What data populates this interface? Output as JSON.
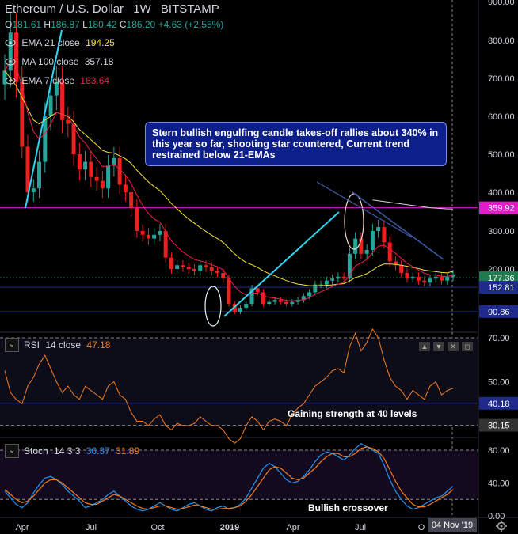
{
  "header": {
    "symbol": "Ethereum / U.S. Dollar",
    "interval": "1W",
    "exchange": "BITSTAMP",
    "ohlc": {
      "o_label": "O",
      "o": "181.61",
      "h_label": "H",
      "h": "186.87",
      "l_label": "L",
      "l": "180.42",
      "c_label": "C",
      "c": "186.20",
      "chg": "+4.63 (+2.55%)"
    }
  },
  "indicators": [
    {
      "label": "EMA 21 close",
      "value": "194.25",
      "color": "#f5e33b"
    },
    {
      "label": "MA 100 close",
      "value": "357.18",
      "color": "#d1d4dc"
    },
    {
      "label": "EMA 7 close",
      "value": "183.64",
      "color": "#ef1f4b"
    }
  ],
  "annotation_box": {
    "text": "Stern bullish engulfing candle takes-off rallies about 340% in this year so far, shooting star countered, Current trend restrained below 21-EMAs"
  },
  "price_badges": [
    {
      "text": "359.92",
      "color": "#e31ec8"
    },
    {
      "text": "177.36",
      "color": "#1f7a4d"
    },
    {
      "text": "152.81",
      "color": "#1e2a8c"
    },
    {
      "text": "90.86",
      "color": "#1e2a8c"
    }
  ],
  "rsi": {
    "label": "RSI",
    "params": "14 close",
    "value": "47.18",
    "value_color": "#f57c1f",
    "badges": [
      {
        "text": "40.18",
        "color": "#1e2a8c"
      },
      {
        "text": "30.15",
        "color": "#333"
      }
    ],
    "annotation": "Gaining strength at 40 levels"
  },
  "stoch": {
    "label": "Stoch",
    "params": "14 3 3",
    "k": "36.37",
    "k_color": "#2196f3",
    "d": "31.89",
    "d_color": "#f57c1f",
    "annotation": "Bullish crossover"
  },
  "x_axis": {
    "labels": [
      "Apr",
      "Jul",
      "Oct",
      "2019",
      "Apr",
      "Jul",
      "O"
    ],
    "crosshair_date": "04 Nov '19"
  },
  "colors": {
    "up": "#26a69a",
    "down": "#ef1f1f",
    "bg": "#000000",
    "hline": "#1e2a8c",
    "magenta": "#e31ec8",
    "cyan": "#2fd4f0"
  },
  "chart_data": [
    {
      "type": "line",
      "title": "Ethereum / U.S. Dollar 1W BITSTAMP",
      "y_ticks": [
        900,
        800,
        700,
        600,
        500,
        400,
        300,
        200
      ],
      "ylim": [
        45,
        900
      ],
      "x_ticks": [
        "Apr",
        "Jul",
        "Oct",
        "2019",
        "Apr",
        "Jul",
        "O"
      ],
      "series": [
        {
          "name": "Close",
          "kind": "candles",
          "values": [
            720,
            820,
            690,
            520,
            400,
            410,
            480,
            600,
            655,
            690,
            590,
            580,
            500,
            460,
            480,
            440,
            430,
            410,
            470,
            490,
            420,
            400,
            360,
            300,
            290,
            280,
            290,
            300,
            230,
            200,
            210,
            205,
            200,
            195,
            210,
            205,
            195,
            190,
            175,
            110,
            90,
            100,
            110,
            150,
            140,
            110,
            115,
            120,
            115,
            110,
            115,
            120,
            130,
            140,
            160,
            160,
            170,
            175,
            180,
            175,
            240,
            280,
            240,
            250,
            300,
            310,
            270,
            220,
            210,
            190,
            175,
            180,
            170,
            165,
            175,
            180,
            170,
            180,
            186
          ]
        },
        {
          "name": "EMA 21 close",
          "values": [
            720,
            700,
            680,
            650,
            620,
            590,
            580,
            590,
            600,
            610,
            605,
            600,
            585,
            565,
            552,
            538,
            525,
            510,
            505,
            503,
            496,
            488,
            476,
            458,
            442,
            427,
            415,
            404,
            388,
            371,
            357,
            343,
            331,
            320,
            309,
            299,
            289,
            280,
            270,
            255,
            240,
            227,
            217,
            211,
            204,
            195,
            188,
            182,
            176,
            170,
            165,
            161,
            159,
            157,
            157,
            157,
            158,
            159,
            161,
            162,
            169,
            178,
            182,
            188,
            197,
            207,
            213,
            213,
            212,
            210,
            207,
            204,
            201,
            197,
            195,
            193,
            191,
            190,
            194
          ]
        },
        {
          "name": "EMA 7 close",
          "values": [
            720,
            745,
            731,
            678,
            609,
            560,
            540,
            555,
            580,
            610,
            605,
            599,
            574,
            545,
            530,
            507,
            488,
            468,
            469,
            474,
            460,
            445,
            423,
            392,
            366,
            345,
            331,
            323,
            299,
            274,
            258,
            245,
            234,
            225,
            221,
            217,
            211,
            206,
            198,
            176,
            155,
            141,
            133,
            137,
            138,
            131,
            127,
            125,
            122,
            119,
            118,
            119,
            121,
            126,
            135,
            141,
            148,
            155,
            161,
            165,
            184,
            208,
            216,
            225,
            243,
            260,
            263,
            252,
            241,
            228,
            215,
            206,
            197,
            189,
            185,
            184,
            181,
            181,
            183
          ]
        },
        {
          "name": "MA 100 close",
          "values": [
            null,
            null,
            null,
            null,
            null,
            null,
            null,
            null,
            null,
            null,
            null,
            null,
            null,
            null,
            null,
            null,
            null,
            null,
            null,
            null,
            null,
            null,
            null,
            null,
            null,
            null,
            null,
            null,
            null,
            null,
            null,
            null,
            null,
            null,
            null,
            null,
            null,
            null,
            null,
            null,
            null,
            null,
            null,
            null,
            null,
            null,
            null,
            null,
            null,
            null,
            null,
            null,
            null,
            null,
            null,
            null,
            null,
            null,
            null,
            null,
            null,
            null,
            null,
            null,
            380,
            378,
            376,
            374,
            372,
            370,
            368,
            366,
            364,
            362,
            360,
            359,
            358,
            357,
            357
          ]
        }
      ],
      "hlines": [
        359.92,
        177.36,
        152.81,
        90.86
      ]
    },
    {
      "type": "line",
      "title": "RSI 14 close",
      "ylim": [
        15,
        85
      ],
      "y_ticks": [
        70,
        50
      ],
      "series": [
        {
          "name": "RSI",
          "values": [
            55,
            45,
            42,
            40,
            48,
            52,
            58,
            62,
            56,
            50,
            45,
            48,
            44,
            42,
            48,
            46,
            44,
            42,
            48,
            50,
            44,
            42,
            36,
            32,
            32,
            30,
            33,
            35,
            30,
            28,
            31,
            30,
            30,
            31,
            34,
            32,
            30,
            30,
            28,
            24,
            22,
            24,
            30,
            34,
            32,
            28,
            32,
            33,
            32,
            30,
            35,
            38,
            40,
            44,
            48,
            50,
            52,
            55,
            56,
            54,
            66,
            72,
            64,
            68,
            74,
            70,
            60,
            52,
            48,
            46,
            42,
            46,
            44,
            42,
            48,
            50,
            44,
            46,
            47
          ]
        }
      ],
      "hlines": [
        70,
        40.18,
        30.15
      ]
    },
    {
      "type": "line",
      "title": "Stoch 14 3 3",
      "ylim": [
        0,
        100
      ],
      "y_ticks": [
        80,
        40,
        0
      ],
      "series": [
        {
          "name": "K",
          "values": [
            30,
            22,
            14,
            10,
            16,
            28,
            38,
            46,
            48,
            44,
            38,
            30,
            24,
            18,
            10,
            12,
            16,
            20,
            26,
            30,
            24,
            18,
            12,
            8,
            6,
            8,
            12,
            16,
            12,
            8,
            6,
            10,
            14,
            16,
            12,
            8,
            6,
            10,
            12,
            8,
            10,
            14,
            22,
            34,
            46,
            58,
            64,
            60,
            52,
            44,
            40,
            42,
            48,
            56,
            66,
            74,
            78,
            76,
            72,
            68,
            74,
            82,
            88,
            84,
            80,
            76,
            62,
            44,
            30,
            20,
            12,
            8,
            10,
            14,
            18,
            22,
            24,
            30,
            36
          ]
        },
        {
          "name": "D",
          "values": [
            32,
            26,
            20,
            16,
            18,
            24,
            32,
            40,
            44,
            44,
            40,
            34,
            28,
            22,
            16,
            14,
            14,
            18,
            22,
            26,
            24,
            20,
            16,
            12,
            9,
            8,
            10,
            12,
            12,
            10,
            8,
            9,
            11,
            13,
            12,
            10,
            8,
            8,
            9,
            9,
            10,
            12,
            18,
            26,
            36,
            46,
            56,
            60,
            58,
            52,
            46,
            44,
            46,
            52,
            58,
            66,
            72,
            76,
            76,
            72,
            72,
            76,
            82,
            84,
            82,
            78,
            70,
            56,
            42,
            30,
            22,
            14,
            11,
            11,
            14,
            18,
            22,
            26,
            32
          ]
        }
      ],
      "hlines": [
        80,
        20
      ]
    }
  ]
}
